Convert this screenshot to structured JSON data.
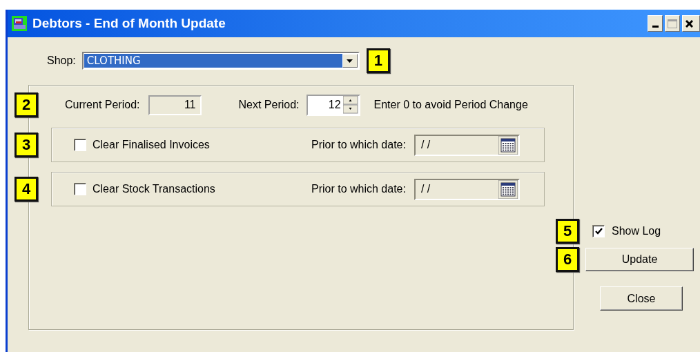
{
  "window": {
    "title": "Debtors - End of Month Update"
  },
  "shop": {
    "badge": "1",
    "label": "Shop:",
    "value": "CLOTHING"
  },
  "period": {
    "badge": "2",
    "current_label": "Current Period:",
    "current_value": "11",
    "next_label": "Next Period:",
    "next_value": "12",
    "hint": "Enter 0 to avoid Period Change"
  },
  "clear_options": [
    {
      "badge": "3",
      "label": "Clear Finalised Invoices",
      "checked": false,
      "date_label": "Prior to which date:",
      "date_value": "/ /"
    },
    {
      "badge": "4",
      "label": "Clear Stock Transactions",
      "checked": false,
      "date_label": "Prior to which date:",
      "date_value": "/ /"
    }
  ],
  "show_log": {
    "badge": "5",
    "label": "Show Log",
    "checked": true
  },
  "update_button": {
    "badge": "6",
    "label": "Update"
  },
  "close_button": {
    "label": "Close"
  }
}
